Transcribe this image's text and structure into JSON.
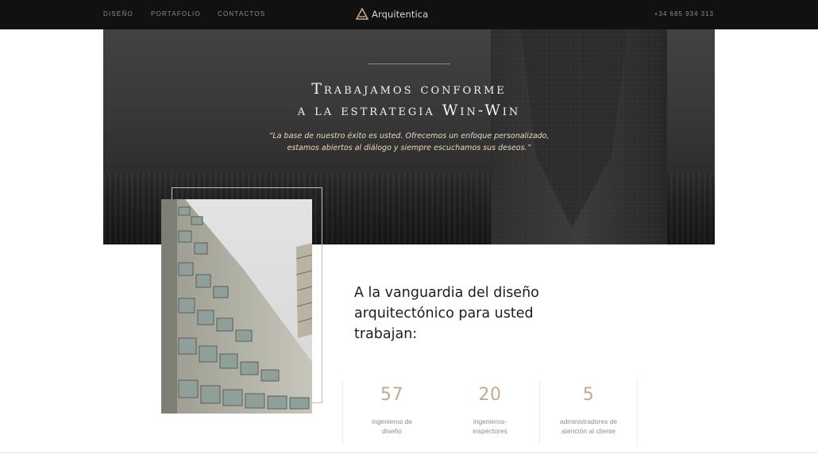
{
  "nav": {
    "links": [
      "DISEÑO",
      "PORTAFOLIO",
      "CONTACTOS"
    ],
    "logo": "Arquitentica",
    "phone": "+34 685 934 313"
  },
  "hero": {
    "title_line1": "Trabajamos conforme",
    "title_line2": "a la estrategia Win-Win",
    "quote_line1": "“La base de nuestro éxito es usted. Ofrecemos un enfoque personalizado,",
    "quote_line2": "estamos abiertos al diálogo y siempre escuchamos sus deseos.”"
  },
  "about": {
    "headline_line1": "A la vanguardia del diseño",
    "headline_line2": "arquitectónico para usted",
    "headline_line3": "trabajan:"
  },
  "stats": [
    {
      "value": "57",
      "label_line1": "ingenieros de",
      "label_line2": "diseño"
    },
    {
      "value": "20",
      "label_line1": "ingenieros-",
      "label_line2": "inspectores"
    },
    {
      "value": "5",
      "label_line1": "administradores de",
      "label_line2": "atención al cliente"
    }
  ],
  "colors": {
    "accent": "#c6a98c",
    "topbar": "#111111",
    "quote": "#e8d6c2"
  },
  "icons": {
    "logo_mark": "triangle-logo-icon"
  }
}
